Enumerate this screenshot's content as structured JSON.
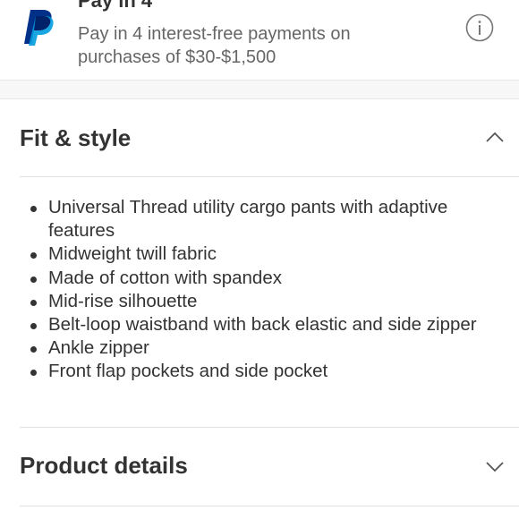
{
  "paypal": {
    "title": "Pay in 4",
    "description": "Pay in 4 interest-free payments on purchases of $30-$1,500",
    "logo_icon": "paypal-logo-icon",
    "info_icon": "info-icon",
    "brand_colors": {
      "dark": "#003087",
      "light": "#009CDE"
    }
  },
  "fit_style": {
    "title": "Fit & style",
    "expanded": true,
    "chevron_icon": "chevron-up-icon",
    "bullets": [
      "Universal Thread utility cargo pants with adaptive features",
      "Midweight twill fabric",
      "Made of cotton with spandex",
      "Mid-rise silhouette",
      "Belt-loop waistband with back elastic and side zipper",
      "Ankle zipper",
      "Front flap pockets and side pocket"
    ]
  },
  "product_details": {
    "title": "Product details",
    "expanded": false,
    "chevron_icon": "chevron-down-icon"
  }
}
